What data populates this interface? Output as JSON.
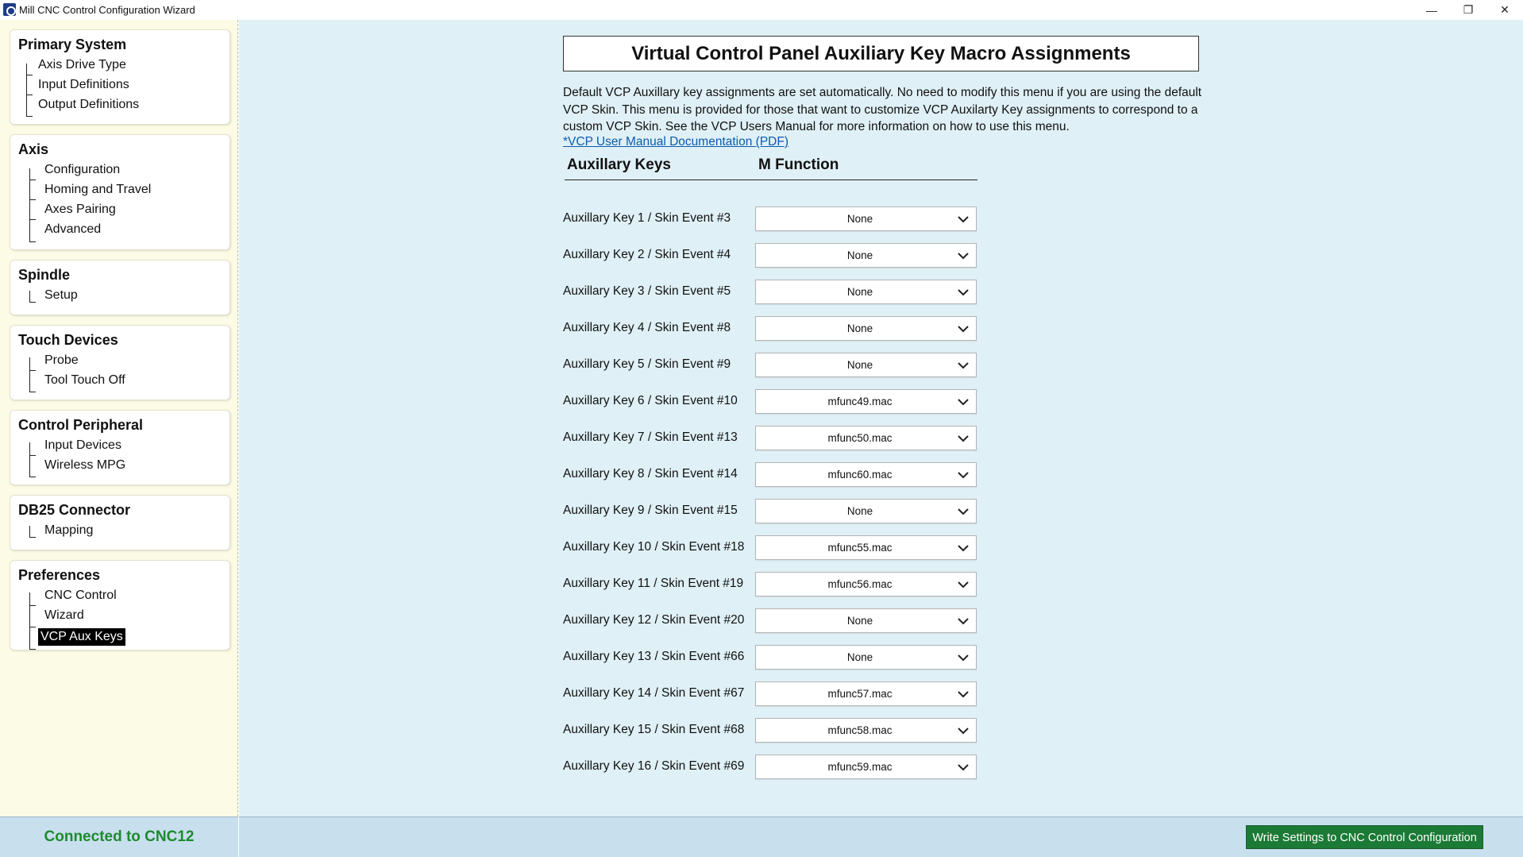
{
  "window": {
    "title": "Mill CNC Control Configuration Wizard",
    "controls": {
      "minimize": "—",
      "maximize": "❐",
      "close": "✕"
    }
  },
  "sidebar": {
    "groups": [
      {
        "title": "Primary System",
        "items": [
          "Axis Drive Type",
          "Input Definitions",
          "Output Definitions"
        ]
      },
      {
        "title": "Axis",
        "items": [
          "Configuration",
          "Homing and Travel",
          "Axes Pairing",
          "Advanced"
        ]
      },
      {
        "title": "Spindle",
        "items": [
          "Setup"
        ]
      },
      {
        "title": "Touch Devices",
        "items": [
          "Probe",
          "Tool Touch Off"
        ]
      },
      {
        "title": "Control Peripheral",
        "items": [
          "Input Devices",
          "Wireless MPG"
        ]
      },
      {
        "title": "DB25 Connector",
        "items": [
          "Mapping"
        ]
      },
      {
        "title": "Preferences",
        "items": [
          "CNC Control",
          "Wizard",
          "VCP Aux Keys"
        ]
      }
    ],
    "selected_item": "VCP Aux Keys"
  },
  "main": {
    "title": "Virtual Control Panel Auxiliary Key Macro Assignments",
    "description": "Default VCP Auxillary key assignments are set automatically. No need to modify this menu if you are using the default VCP Skin. This menu is provided for those that want to customize VCP Auxilarty Key assignments to correspond to a custom VCP Skin. See the VCP Users Manual for more information on how to use this menu.",
    "doc_link": "*VCP User Manual Documentation (PDF)",
    "col_keys": "Auxillary Keys",
    "col_function": "M Function",
    "rows": [
      {
        "label": "Auxillary Key 1 / Skin Event #3",
        "value": "None"
      },
      {
        "label": "Auxillary Key 2 / Skin Event #4",
        "value": "None"
      },
      {
        "label": "Auxillary Key 3 / Skin Event #5",
        "value": "None"
      },
      {
        "label": "Auxillary Key 4 / Skin Event #8",
        "value": "None"
      },
      {
        "label": "Auxillary Key 5 / Skin Event #9",
        "value": "None"
      },
      {
        "label": "Auxillary Key 6 / Skin Event #10",
        "value": "mfunc49.mac"
      },
      {
        "label": "Auxillary Key 7 / Skin Event #13",
        "value": "mfunc50.mac"
      },
      {
        "label": "Auxillary Key 8 / Skin Event #14",
        "value": "mfunc60.mac"
      },
      {
        "label": "Auxillary Key 9 / Skin Event #15",
        "value": "None"
      },
      {
        "label": "Auxillary Key 10 / Skin Event #18",
        "value": "mfunc55.mac"
      },
      {
        "label": "Auxillary Key 11 / Skin Event #19",
        "value": "mfunc56.mac"
      },
      {
        "label": "Auxillary Key 12 / Skin Event #20",
        "value": "None"
      },
      {
        "label": "Auxillary Key 13 / Skin Event #66",
        "value": "None"
      },
      {
        "label": "Auxillary Key 14 / Skin Event #67",
        "value": "mfunc57.mac"
      },
      {
        "label": "Auxillary Key 15 / Skin Event #68",
        "value": "mfunc58.mac"
      },
      {
        "label": "Auxillary Key 16 / Skin Event #69",
        "value": "mfunc59.mac"
      }
    ]
  },
  "status": {
    "connection": "Connected to CNC12",
    "write_button": "Write Settings to CNC Control Configuration"
  },
  "colors": {
    "sidebar_bg": "#fcfbe6",
    "main_bg": "#dff0f6",
    "status_bg": "#c8dfee",
    "connected_green": "#1e8a2e",
    "write_button_bg": "#1b7a35",
    "link_blue": "#0b5cad"
  }
}
